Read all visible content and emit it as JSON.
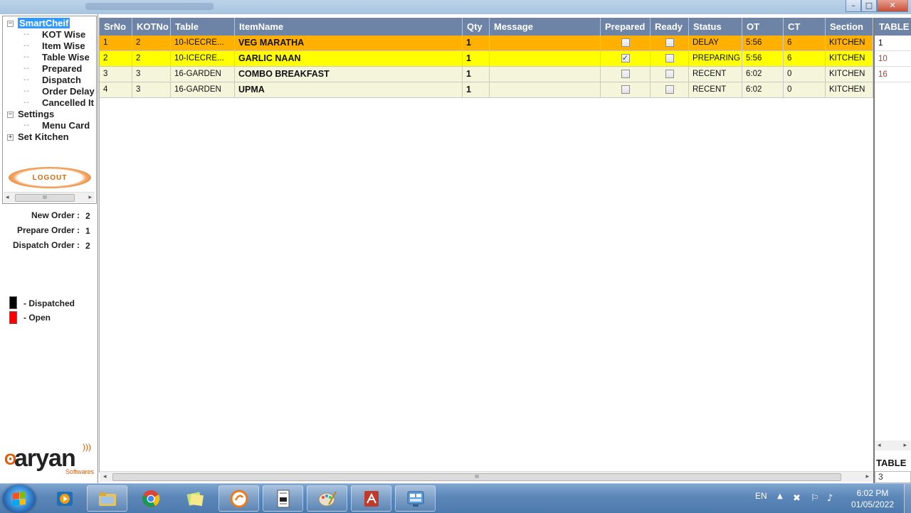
{
  "window": {
    "minimize": "–",
    "maximize": "□",
    "close": "✕"
  },
  "tree": {
    "root": "SmartCheif",
    "children": [
      "KOT Wise",
      "Item Wise",
      "Table Wise",
      "Prepared",
      "Dispatch",
      "Order Delay",
      "Cancelled It"
    ],
    "settings": "Settings",
    "settings_children": [
      "Menu Card"
    ],
    "set_kitchen": "Set Kitchen",
    "collapse_glyph": "−",
    "expand_glyph": "+"
  },
  "logout_label": "LOGOUT",
  "scroll_thumb_glyph": "III",
  "stats": {
    "new_order_label": "New Order :",
    "new_order_value": "2",
    "prepare_order_label": "Prepare Order :",
    "prepare_order_value": "1",
    "dispatch_order_label": "Dispatch Order :",
    "dispatch_order_value": "2"
  },
  "legend": [
    {
      "label": "- Dispatched",
      "color": "#000000"
    },
    {
      "label": "- Open",
      "color": "#ff0000"
    }
  ],
  "brand": {
    "name": "aryan",
    "sub": "Softwares"
  },
  "grid": {
    "columns": [
      "SrNo",
      "KOTNo",
      "Table",
      "ItemName",
      "Qty",
      "Message",
      "Prepared",
      "Ready",
      "Status",
      "OT",
      "CT",
      "Section"
    ],
    "rows": [
      {
        "srno": "1",
        "kotno": "2",
        "table": "10-ICECRE...",
        "item": "VEG MARATHA",
        "qty": "1",
        "message": "",
        "prepared": false,
        "ready": false,
        "status": "DELAY",
        "ot": "5:56",
        "ct": "6",
        "section": "KITCHEN",
        "bg": "#ffb000"
      },
      {
        "srno": "2",
        "kotno": "2",
        "table": "10-ICECRE...",
        "item": "GARLIC NAAN",
        "qty": "1",
        "message": "",
        "prepared": true,
        "ready": false,
        "status": "PREPARING",
        "ot": "5:56",
        "ct": "6",
        "section": "KITCHEN",
        "bg": "#ffff00"
      },
      {
        "srno": "3",
        "kotno": "3",
        "table": "16-GARDEN",
        "item": "COMBO BREAKFAST",
        "qty": "1",
        "message": "",
        "prepared": false,
        "ready": false,
        "status": "RECENT",
        "ot": "6:02",
        "ct": "0",
        "section": "KITCHEN",
        "bg": "#f5f5dc"
      },
      {
        "srno": "4",
        "kotno": "3",
        "table": "16-GARDEN",
        "item": "UPMA",
        "qty": "1",
        "message": "",
        "prepared": false,
        "ready": false,
        "status": "RECENT",
        "ot": "6:02",
        "ct": "0",
        "section": "KITCHEN",
        "bg": "#f5f5dc"
      }
    ],
    "checkmark": "✓"
  },
  "right_panel": {
    "header": "TABLE",
    "items": [
      {
        "label": "1",
        "color": "#000000"
      },
      {
        "label": "10",
        "color": "#c0392b"
      },
      {
        "label": "16",
        "color": "#c0392b"
      }
    ],
    "footer_label": "TABLE",
    "footer_value": "3"
  },
  "taskbar": {
    "apps": [
      "media-player",
      "file-explorer",
      "chrome",
      "sticky-notes",
      "smartcheif",
      "document-viewer",
      "paint",
      "pdf-app",
      "control-panel"
    ],
    "lang": "EN",
    "time": "6:02 PM",
    "date": "01/05/2022"
  },
  "colors": {
    "header": "#6d84a7",
    "accent": "#3399ff"
  }
}
